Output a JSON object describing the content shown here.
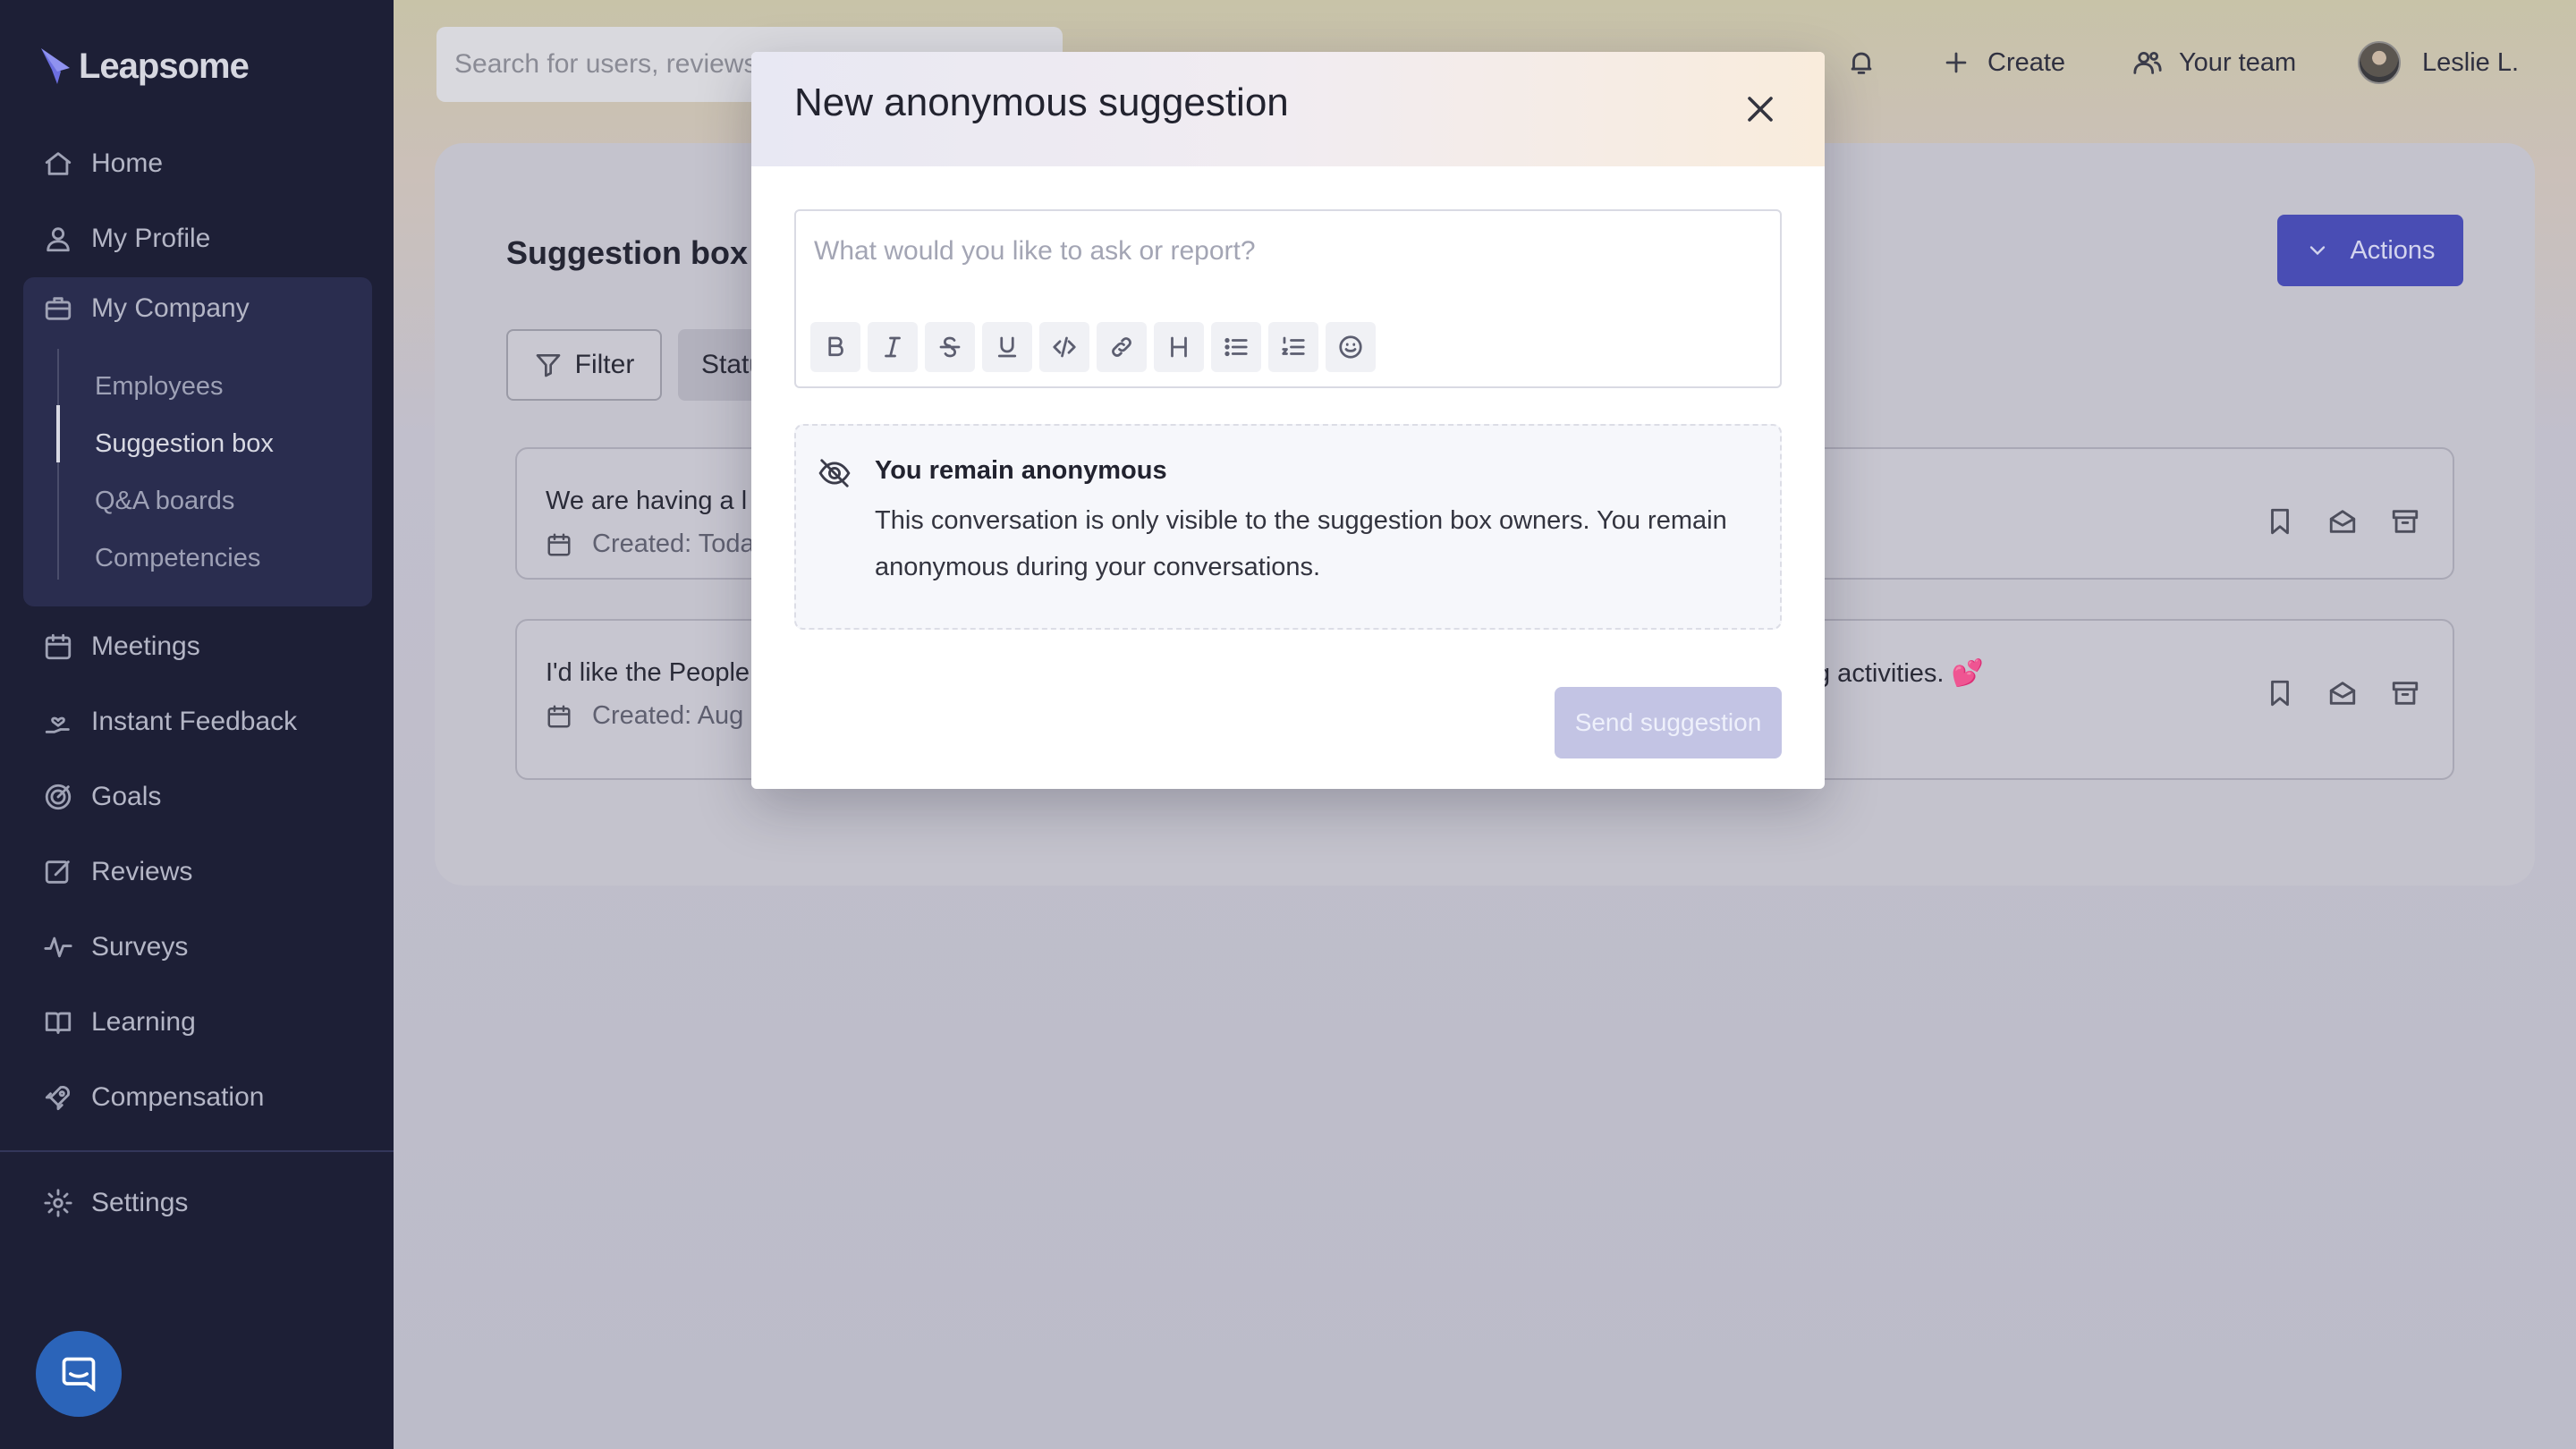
{
  "app": {
    "name": "Leapsome"
  },
  "sidebar": {
    "items": [
      {
        "label": "Home",
        "icon": "home-icon"
      },
      {
        "label": "My Profile",
        "icon": "user-icon"
      },
      {
        "label": "My Company",
        "icon": "briefcase-icon"
      },
      {
        "label": "Meetings",
        "icon": "calendar-icon"
      },
      {
        "label": "Instant Feedback",
        "icon": "hand-heart-icon"
      },
      {
        "label": "Goals",
        "icon": "target-icon"
      },
      {
        "label": "Reviews",
        "icon": "edit-icon"
      },
      {
        "label": "Surveys",
        "icon": "pulse-icon"
      },
      {
        "label": "Learning",
        "icon": "book-icon"
      },
      {
        "label": "Compensation",
        "icon": "rocket-icon"
      }
    ],
    "company_subitems": [
      {
        "label": "Employees"
      },
      {
        "label": "Suggestion box",
        "active": true
      },
      {
        "label": "Q&A boards"
      },
      {
        "label": "Competencies"
      }
    ],
    "settings": {
      "label": "Settings",
      "icon": "gear-icon"
    }
  },
  "topbar": {
    "search_placeholder": "Search for users, reviews",
    "create_label": "Create",
    "team_label": "Your team",
    "user_name": "Leslie L."
  },
  "page": {
    "title": "Suggestion box",
    "actions_label": "Actions",
    "filter_label": "Filter",
    "status_label": "Statu",
    "suggestions": [
      {
        "text_start": "We are having a l",
        "text_end": "",
        "created": "Created: Toda"
      },
      {
        "text_start": "I'd like the People",
        "text_end": "g activities. 💕",
        "created": "Created: Aug"
      }
    ]
  },
  "modal": {
    "title": "New anonymous suggestion",
    "editor_placeholder": "What would you like to ask or report?",
    "toolbar": [
      "bold-icon",
      "italic-icon",
      "strikethrough-icon",
      "underline-icon",
      "code-icon",
      "link-icon",
      "heading-icon",
      "bullet-list-icon",
      "numbered-list-icon",
      "emoji-icon"
    ],
    "notice_title": "You remain anonymous",
    "notice_text": "This conversation is only visible to the suggestion box owners. You remain anonymous during your conversations.",
    "send_label": "Send suggestion"
  },
  "colors": {
    "sidebar_bg": "#1d1f36",
    "accent": "#494db4",
    "send_disabled": "#c3c4e4"
  }
}
